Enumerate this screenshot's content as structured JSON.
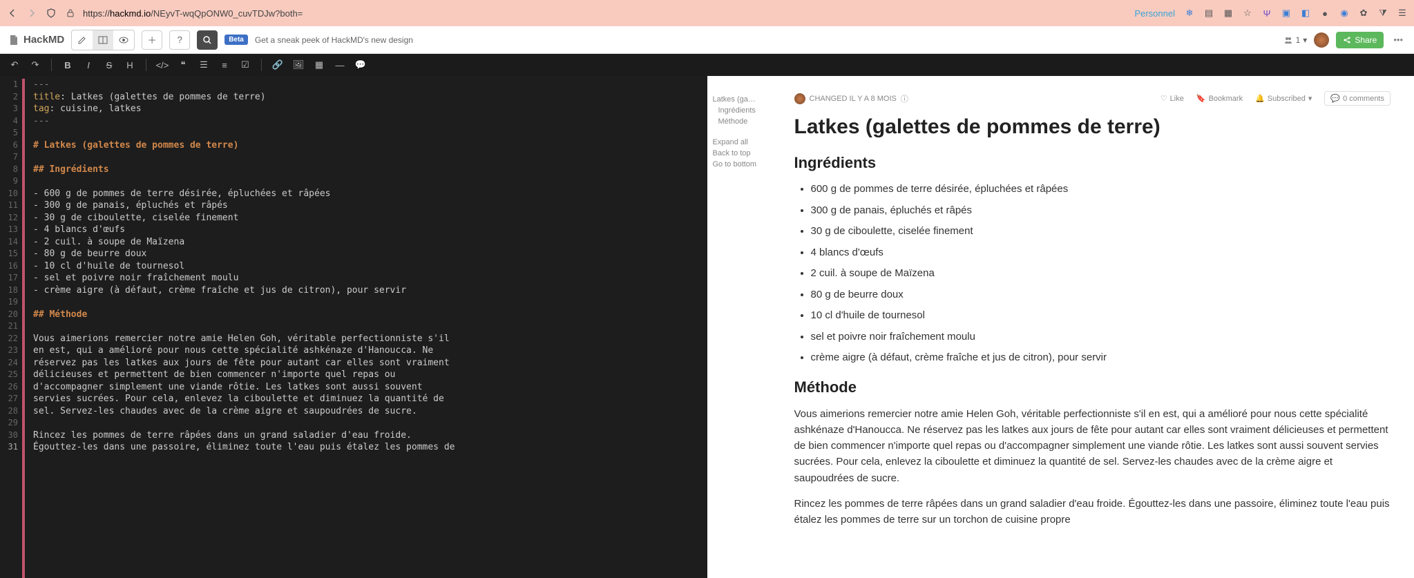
{
  "browser": {
    "url_prefix": "https://",
    "host": "hackmd.io",
    "path": "/NEyvT-wqQpONW0_cuvTDJw?both=",
    "personnel": "Personnel"
  },
  "app": {
    "logo": "HackMD",
    "beta": "Beta",
    "promo": "Get a sneak peek of HackMD's new design",
    "user_count": "1",
    "share": "Share"
  },
  "outline": {
    "title": "Latkes (ga…",
    "s1": "Ingrédients",
    "s2": "Méthode",
    "expand": "Expand all",
    "back": "Back to top",
    "bottom": "Go to bottom"
  },
  "meta": {
    "changed": "CHANGED IL Y A 8 MOIS",
    "like": "Like",
    "bookmark": "Bookmark",
    "subscribed": "Subscribed",
    "comments": "0 comments"
  },
  "doc": {
    "front_matter_title_key": "title",
    "front_matter_title_val": ": Latkes (galettes de pommes de terre)",
    "front_matter_tag_key": "tag",
    "front_matter_tag_val": ": cuisine, latkes",
    "h1": "# Latkes (galettes de pommes de terre)",
    "h2a": "## Ingrédients",
    "h2b": "## Méthode",
    "ing": [
      "- 600 g de pommes de terre désirée, épluchées et râpées",
      "- 300 g de panais, épluchés et râpés",
      "- 30 g de ciboulette, ciselée finement",
      "- 4 blancs d'œufs",
      "- 2 cuil. à soupe de Maïzena",
      "- 80 g de beurre doux",
      "- 10 cl d'huile de tournesol",
      "- sel et poivre noir fraîchement moulu",
      "- crème aigre (à défaut, crème fraîche et jus de citron), pour servir"
    ],
    "para1_lines": [
      "Vous aimerions remercier notre amie Helen Goh, véritable perfectionniste s'il",
      "en est, qui a amélioré pour nous cette spécialité ashkénaze d'Hanoucca. Ne",
      "réservez pas les latkes aux jours de fête pour autant car elles sont vraiment",
      "délicieuses et permettent de bien commencer n'importe quel repas ou",
      "d'accompagner simplement une viande rôtie. Les latkes sont aussi souvent",
      "servies sucrées. Pour cela, enlevez la ciboulette et diminuez la quantité de",
      "sel. Servez-les chaudes avec de la crème aigre et saupoudrées de sucre."
    ],
    "para2_lines": [
      "Rincez les pommes de terre râpées dans un grand saladier d'eau froide.",
      "Égouttez-les dans une passoire, éliminez toute l'eau puis étalez les pommes de"
    ]
  },
  "preview": {
    "h1": "Latkes (galettes de pommes de terre)",
    "h2a": "Ingrédients",
    "h2b": "Méthode",
    "ing": [
      "600 g de pommes de terre désirée, épluchées et râpées",
      "300 g de panais, épluchés et râpés",
      "30 g de ciboulette, ciselée finement",
      "4 blancs d'œufs",
      "2 cuil. à soupe de Maïzena",
      "80 g de beurre doux",
      "10 cl d'huile de tournesol",
      "sel et poivre noir fraîchement moulu",
      "crème aigre (à défaut, crème fraîche et jus de citron), pour servir"
    ],
    "p1": "Vous aimerions remercier notre amie Helen Goh, véritable perfectionniste s'il en est, qui a amélioré pour nous cette spécialité ashkénaze d'Hanoucca. Ne réservez pas les latkes aux jours de fête pour autant car elles sont vraiment délicieuses et permettent de bien commencer n'importe quel repas ou d'accompagner simplement une viande rôtie. Les latkes sont aussi souvent servies sucrées. Pour cela, enlevez la ciboulette et diminuez la quantité de sel. Servez-les chaudes avec de la crème aigre et saupoudrées de sucre.",
    "p2": "Rincez les pommes de terre râpées dans un grand saladier d'eau froide. Égouttez-les dans une passoire, éliminez toute l'eau puis étalez les pommes de terre sur un torchon de cuisine propre"
  }
}
